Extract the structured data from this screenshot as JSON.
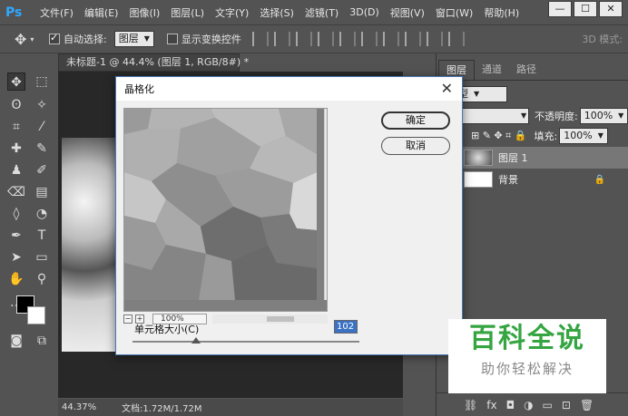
{
  "app": {
    "logo": "Ps"
  },
  "menu": [
    "文件(F)",
    "编辑(E)",
    "图像(I)",
    "图层(L)",
    "文字(Y)",
    "选择(S)",
    "滤镜(T)",
    "3D(D)",
    "视图(V)",
    "窗口(W)",
    "帮助(H)"
  ],
  "window_buttons": {
    "minimize": "—",
    "restore": "☐",
    "close": "✕"
  },
  "options": {
    "auto_select_label": "自动选择:",
    "auto_select_value": "图层",
    "show_transform_label": "显示变换控件",
    "mode_3d_label": "3D 模式:"
  },
  "document": {
    "tab_title": "未标题-1 @ 44.4% (图层 1, RGB/8#) *",
    "status_zoom": "44.37%",
    "status_doc": "文档:1.72M/1.72M"
  },
  "layers_panel": {
    "tabs": [
      "图层",
      "通道",
      "路径"
    ],
    "kind_label": "类型",
    "opacity_label": "不透明度:",
    "opacity_value": "100%",
    "fill_label": "填充:",
    "fill_value": "100%",
    "layers": [
      {
        "name": "图层 1"
      },
      {
        "name": "背景"
      }
    ],
    "footer_icons": [
      "link-icon",
      "fx-icon",
      "mask-icon",
      "adjustment-icon",
      "folder-icon",
      "new-layer-icon",
      "trash-icon"
    ]
  },
  "dialog": {
    "title": "晶格化",
    "ok_label": "确定",
    "cancel_label": "取消",
    "zoom_value": "100%",
    "cell_size_label": "单元格大小(C)",
    "cell_size_value": "102",
    "cell_size_fraction": 0.28
  },
  "watermark": {
    "title": "百科全说",
    "subtitle": "助你轻松解决"
  },
  "colors": {
    "accent": "#31a8ff",
    "watermark_green": "#35a542"
  }
}
